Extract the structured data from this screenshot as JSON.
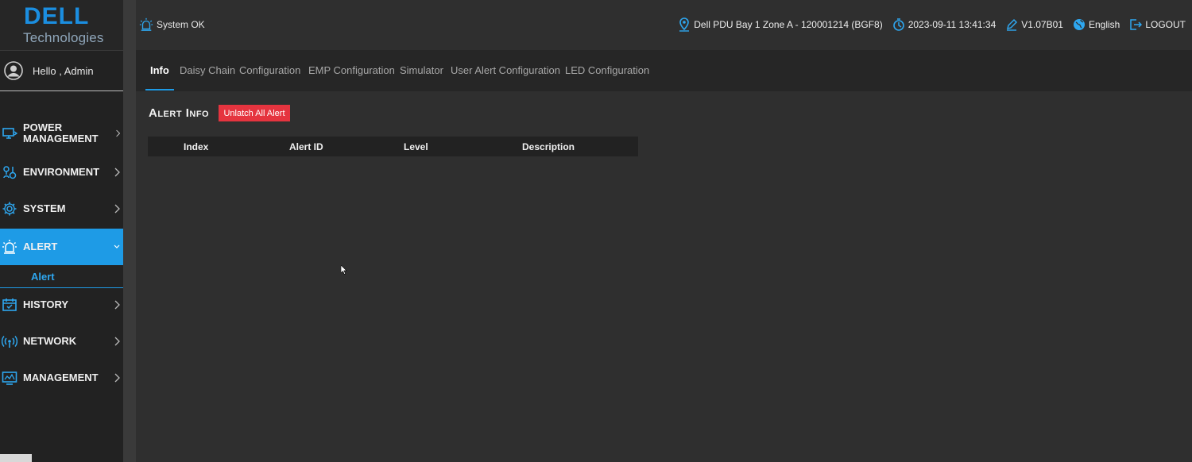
{
  "brand": {
    "name": "DELL",
    "tagline": "Technologies",
    "color": "#1b8ee0"
  },
  "user": {
    "greeting": "Hello , Admin"
  },
  "sidebar": {
    "items": [
      {
        "label": "POWER MANAGEMENT",
        "icon": "power-monitor-icon"
      },
      {
        "label": "ENVIRONMENT",
        "icon": "environment-icon"
      },
      {
        "label": "SYSTEM",
        "icon": "gear-icon"
      },
      {
        "label": "ALERT",
        "icon": "alarm-light-icon",
        "active": true
      },
      {
        "label": "HISTORY",
        "icon": "calendar-icon"
      },
      {
        "label": "NETWORK",
        "icon": "wireless-icon"
      },
      {
        "label": "MANAGEMENT",
        "icon": "management-monitor-icon"
      }
    ],
    "sub_item": "Alert",
    "active_color": "#1e9be6"
  },
  "header": {
    "system_status": "System OK",
    "location": "Dell PDU Bay 1 Zone A - 120001214 (BGF8)",
    "datetime": "2023-09-11 13:41:34",
    "version": "V1.07B01",
    "language": "English",
    "logout": "LOGOUT"
  },
  "tabs": [
    {
      "label": "Info",
      "active": true
    },
    {
      "label": "Daisy Chain"
    },
    {
      "label": "Configuration"
    },
    {
      "label": "EMP Configuration"
    },
    {
      "label": "Simulator"
    },
    {
      "label": "User Alert Configuration"
    },
    {
      "label": "LED Configuration"
    }
  ],
  "alert_info": {
    "title": "Alert Info",
    "unlatch_button": "Unlatch All Alert",
    "button_color": "#e5343f",
    "columns": [
      "Index",
      "Alert ID",
      "Level",
      "Description"
    ],
    "rows": []
  }
}
